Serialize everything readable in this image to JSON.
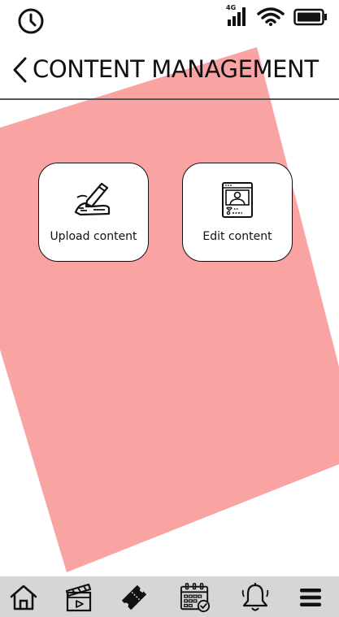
{
  "status_bar": {
    "network_label": "4G",
    "icons": [
      "clock-icon",
      "signal-icon",
      "wifi-icon",
      "battery-icon"
    ]
  },
  "header": {
    "title": "CONTENT MANAGEMENT",
    "back_icon": "chevron-left-icon"
  },
  "actions": [
    {
      "label": "Upload content",
      "icon": "hand-writing-icon"
    },
    {
      "label": "Edit content",
      "icon": "profile-post-icon"
    }
  ],
  "bottom_nav": {
    "items": [
      "home-icon",
      "video-clapper-icon",
      "ticket-icon",
      "calendar-check-icon",
      "bell-icon",
      "menu-icon"
    ]
  },
  "colors": {
    "accent_shape": "#f9a3a3",
    "nav_background": "#d6d6d6",
    "divider": "#555555"
  }
}
